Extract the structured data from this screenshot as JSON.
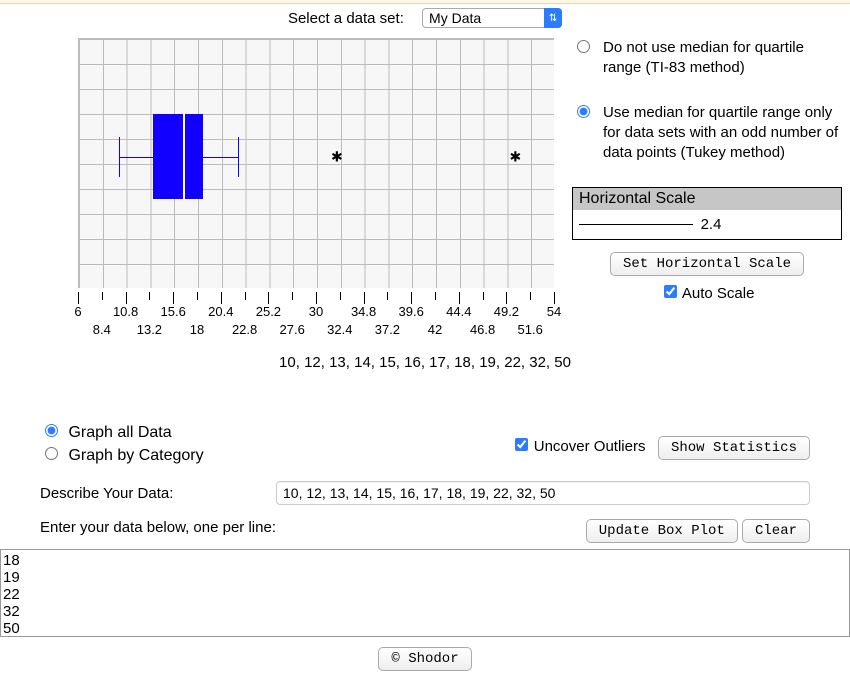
{
  "selector": {
    "label": "Select a data set:",
    "value": "My Data"
  },
  "chart_data": {
    "type": "box",
    "values": [
      10,
      12,
      13,
      14,
      15,
      16,
      17,
      18,
      19,
      22,
      32,
      50
    ],
    "min_whisker": 10,
    "q1": 13.5,
    "median": 16.5,
    "q3": 18.5,
    "max_whisker": 22,
    "outliers": [
      32,
      50
    ],
    "x_range": [
      6,
      54
    ],
    "x_ticks_major": [
      6,
      10.8,
      15.6,
      20.4,
      25.2,
      30,
      34.8,
      39.6,
      44.4,
      49.2,
      54
    ],
    "x_ticks_minor": [
      8.4,
      13.2,
      18,
      22.8,
      27.6,
      32.4,
      37.2,
      42,
      46.8,
      51.6
    ]
  },
  "method_options": {
    "opt1": "Do not use median for quartile range (TI-83 method)",
    "opt2": "Use median for quartile range only for data sets with an odd number of data points (Tukey method)",
    "selected": "opt2"
  },
  "horizontal_scale": {
    "title": "Horizontal Scale",
    "value": "2.4",
    "set_button": "Set Horizontal Scale",
    "auto_label": "Auto Scale",
    "auto_checked": true
  },
  "data_line": "10, 12, 13, 14, 15, 16, 17, 18, 19, 22, 32, 50",
  "graph_mode": {
    "all": "Graph all Data",
    "cat": "Graph by Category",
    "selected": "all"
  },
  "uncover_outliers": {
    "label": "Uncover Outliers",
    "checked": true
  },
  "show_stats_button": "Show Statistics",
  "describe": {
    "label": "Describe Your Data:",
    "value": "10, 12, 13, 14, 15, 16, 17, 18, 19, 22, 32, 50"
  },
  "enter_label": "Enter your data below, one per line:",
  "update_button": "Update Box Plot",
  "clear_button": "Clear",
  "data_textarea": "18\n19\n22\n32\n50",
  "footer": "© Shodor"
}
